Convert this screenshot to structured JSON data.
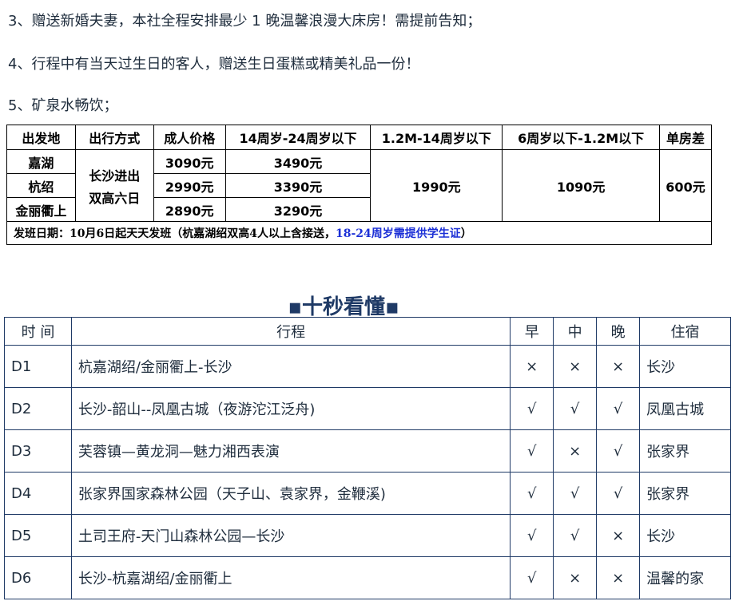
{
  "notes": [
    "3、赠送新婚夫妻，本社全程安排最少 1  晚温馨浪漫大床房！需提前告知；",
    "4、行程中有当天过生日的客人，赠送生日蛋糕或精美礼品一份！",
    "5、矿泉水畅饮；"
  ],
  "price_table": {
    "headers": [
      "出发地",
      "出行方式",
      "成人价格",
      "14周岁-24周岁以下",
      "1.2M-14周岁以下",
      "6周岁以下-1.2M以下",
      "单房差"
    ],
    "mode": [
      "长沙进出",
      "双高六日"
    ],
    "rows": [
      {
        "origin": "嘉湖",
        "adult": "3090元",
        "youth": "3490元"
      },
      {
        "origin": "杭绍",
        "adult": "2990元",
        "youth": "3390元"
      },
      {
        "origin": "金丽衢上",
        "adult": "2890元",
        "youth": "3290元"
      }
    ],
    "child_price": "1990元",
    "infant_price": "1090元",
    "single_supplement": "600元",
    "footer_text": "发班日期：10月6日起天天发班（杭嘉湖绍双高4人以上含接送，",
    "footer_highlight": "18-24周岁需提供学生证",
    "footer_end": "）"
  },
  "section_title": "▪十秒看懂▪",
  "itinerary": {
    "headers": [
      "时 间",
      "行程",
      "早",
      "中",
      "晚",
      "住宿"
    ],
    "rows": [
      {
        "day": "D1",
        "route": "杭嘉湖绍/金丽衢上-长沙",
        "b": "×",
        "l": "×",
        "d": "×",
        "stay": "长沙"
      },
      {
        "day": "D2",
        "route": "长沙-韶山--凤凰古城（夜游沱江泛舟)",
        "b": "√",
        "l": "√",
        "d": "√",
        "stay": "凤凰古城"
      },
      {
        "day": "D3",
        "route": "芙蓉镇—黄龙洞—魅力湘西表演",
        "b": "√",
        "l": "×",
        "d": "√",
        "stay": "张家界"
      },
      {
        "day": "D4",
        "route": "张家界国家森林公园（天子山、袁家界，金鞭溪)",
        "b": "√",
        "l": "√",
        "d": "√",
        "stay": "张家界"
      },
      {
        "day": "D5",
        "route": "土司王府-天门山森林公园—长沙",
        "b": "√",
        "l": "√",
        "d": "×",
        "stay": "长沙"
      },
      {
        "day": "D6",
        "route": "长沙-杭嘉湖绍/金丽衢上",
        "b": "√",
        "l": "×",
        "d": "×",
        "stay": "温馨的家"
      }
    ]
  }
}
